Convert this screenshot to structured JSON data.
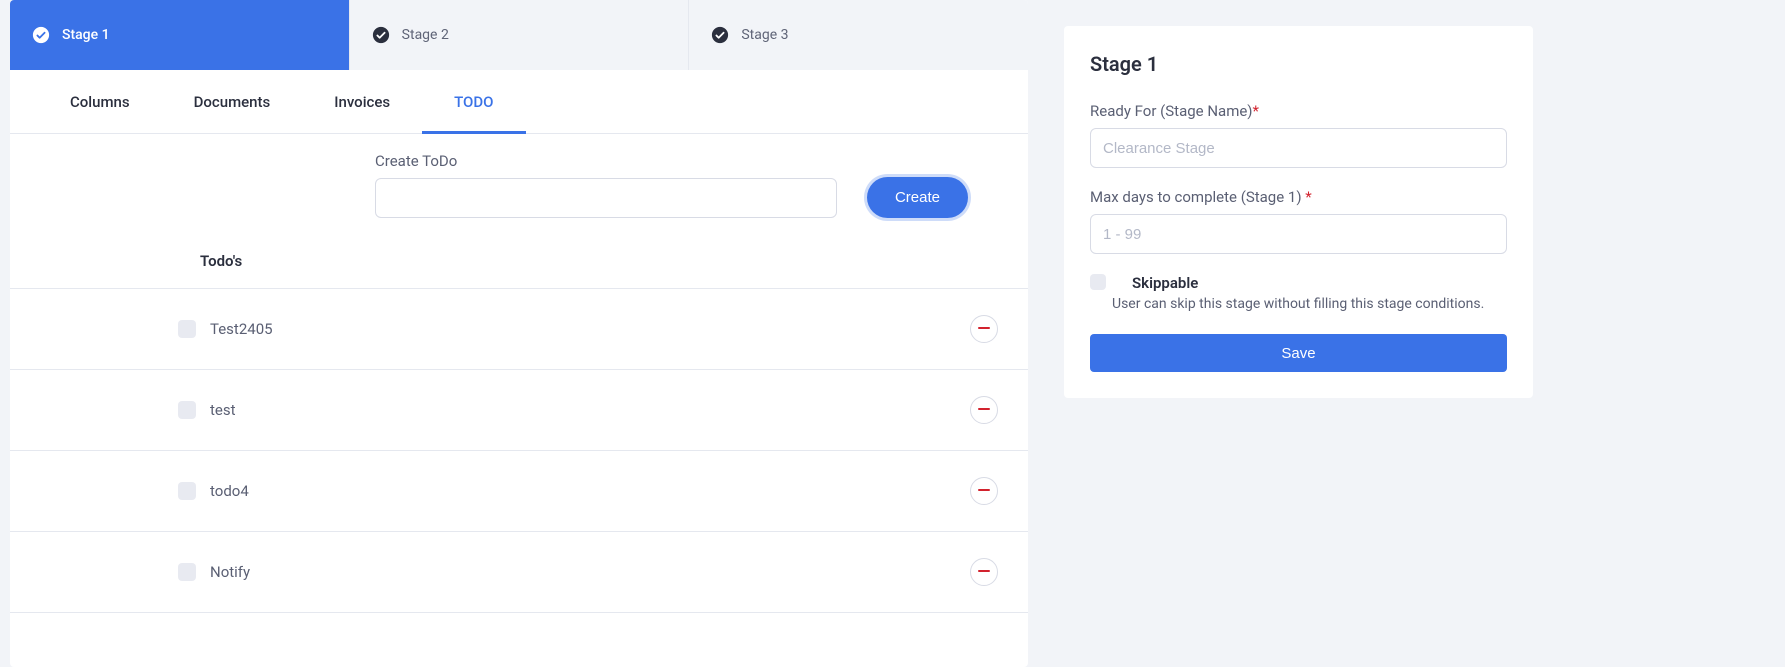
{
  "stage_tabs": [
    {
      "label": "Stage 1",
      "active": true
    },
    {
      "label": "Stage 2",
      "active": false
    },
    {
      "label": "Stage 3",
      "active": false
    }
  ],
  "sub_tabs": [
    {
      "label": "Columns",
      "active": false
    },
    {
      "label": "Documents",
      "active": false
    },
    {
      "label": "Invoices",
      "active": false
    },
    {
      "label": "TODO",
      "active": true
    }
  ],
  "create_todo": {
    "label": "Create ToDo",
    "button": "Create",
    "value": ""
  },
  "todos_header": "Todo's",
  "todos": [
    {
      "label": "Test2405"
    },
    {
      "label": "test"
    },
    {
      "label": "todo4"
    },
    {
      "label": "Notify"
    }
  ],
  "side": {
    "title": "Stage 1",
    "ready_for_label": "Ready For (Stage Name)",
    "ready_for_placeholder": "Clearance Stage",
    "max_days_label": "Max days to complete (Stage 1) ",
    "max_days_placeholder": "1 - 99",
    "skippable_label": "Skippable",
    "skippable_desc": "User can skip this stage without filling this stage conditions.",
    "save": "Save"
  },
  "colors": {
    "primary": "#3a72e7"
  }
}
